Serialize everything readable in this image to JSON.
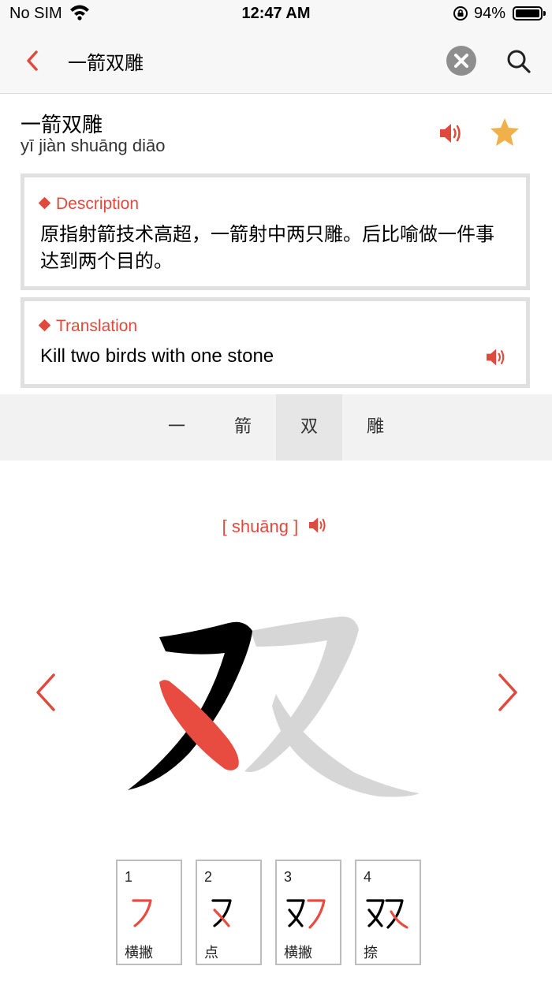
{
  "status_bar": {
    "carrier": "No SIM",
    "time": "12:47 AM",
    "battery": "94%"
  },
  "header": {
    "query": "一箭双雕"
  },
  "entry": {
    "word": "一箭双雕",
    "pinyin": "yī jiàn shuāng diāo"
  },
  "description": {
    "title": "Description",
    "text": "原指射箭技术高超，一箭射中两只雕。后比喻做一件事达到两个目的。"
  },
  "translation": {
    "title": "Translation",
    "text": "Kill two birds with one stone"
  },
  "char_tabs": [
    "一",
    "箭",
    "双",
    "雕"
  ],
  "selected_char": "双",
  "detail": {
    "pronunciation": "[ shuāng ]"
  },
  "strokes": [
    {
      "num": "1",
      "name": "横撇"
    },
    {
      "num": "2",
      "name": "点"
    },
    {
      "num": "3",
      "name": "横撇"
    },
    {
      "num": "4",
      "name": "捺"
    }
  ],
  "colors": {
    "accent": "#e04a3c",
    "star": "#f0b04a",
    "grey_glyph": "#d6d6d6"
  }
}
